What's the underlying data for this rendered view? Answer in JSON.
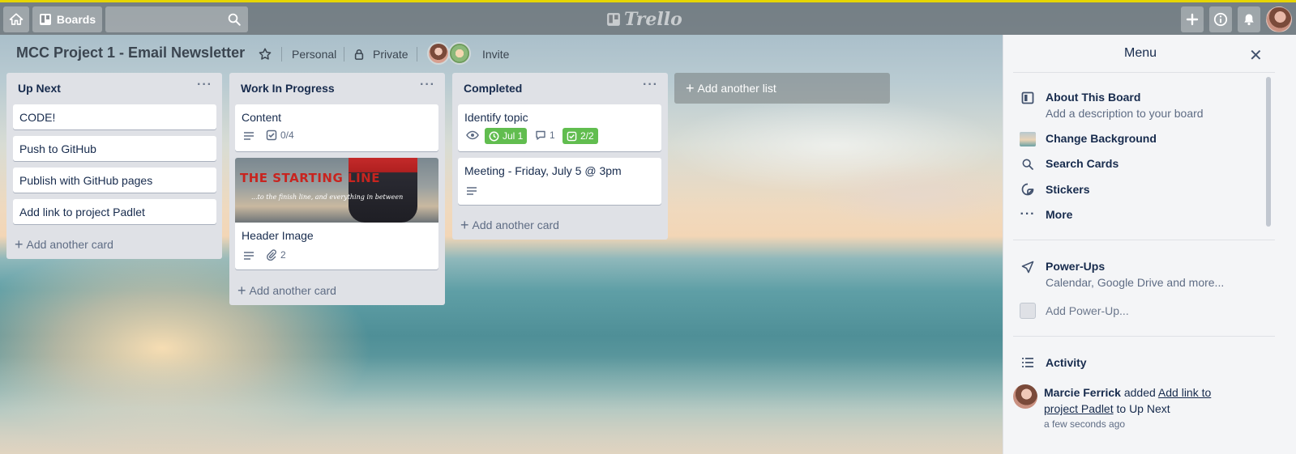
{
  "app": {
    "logo": "Trello",
    "boards_label": "Boards",
    "yellow_accent": "#e6d500"
  },
  "board": {
    "title": "MCC Project 1 - Email Newsletter",
    "team": "Personal",
    "visibility": "Private",
    "invite_label": "Invite"
  },
  "lists": [
    {
      "name": "Up Next",
      "cards": [
        {
          "title": "CODE!"
        },
        {
          "title": "Push to GitHub"
        },
        {
          "title": "Publish with GitHub pages"
        },
        {
          "title": "Add link to project Padlet"
        }
      ],
      "add_card": "Add another card"
    },
    {
      "name": "Work In Progress",
      "cards": [
        {
          "title": "Content",
          "checklist": "0/4"
        },
        {
          "title": "Header Image",
          "attachments": "2",
          "cover": {
            "headline": "THE STARTING LINE",
            "tagline": "...to the finish line, and everything in between"
          }
        }
      ],
      "add_card": "Add another card"
    },
    {
      "name": "Completed",
      "cards": [
        {
          "title": "Identify topic",
          "due": "Jul 1",
          "comments": "1",
          "checklist": "2/2"
        },
        {
          "title": "Meeting - Friday, July 5 @ 3pm"
        }
      ],
      "add_card": "Add another card"
    }
  ],
  "add_list": "Add another list",
  "menu": {
    "title": "Menu",
    "items": [
      {
        "label": "About This Board",
        "sub": "Add a description to your board",
        "icon": "board-icon"
      },
      {
        "label": "Change Background",
        "icon": "background-thumbnail"
      },
      {
        "label": "Search Cards",
        "icon": "search-icon"
      },
      {
        "label": "Stickers",
        "icon": "sticker-icon"
      },
      {
        "label": "More",
        "icon": "more-icon"
      }
    ],
    "powerups": {
      "label": "Power-Ups",
      "sub": "Calendar, Google Drive and more...",
      "add": "Add Power-Up..."
    },
    "activity": {
      "label": "Activity",
      "entry": {
        "user": "Marcie Ferrick",
        "verb": "added",
        "card_link": "Add link to project Padlet",
        "to": "to Up Next",
        "time": "a few seconds ago"
      }
    }
  },
  "colors": {
    "green_badge": "#61bd4f",
    "list_bg": "#dfe1e6",
    "menu_bg": "#f4f5f7"
  }
}
